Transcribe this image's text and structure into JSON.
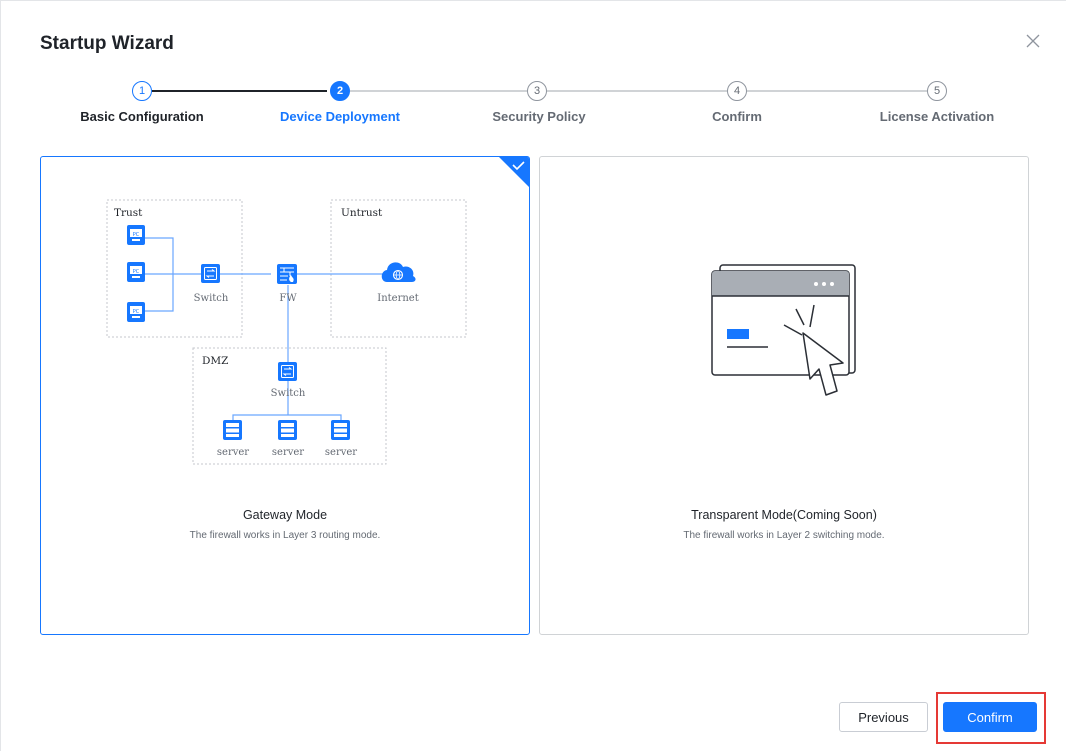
{
  "dialog": {
    "title": "Startup Wizard",
    "close_icon": "close-icon"
  },
  "steps": [
    {
      "number": "1",
      "label": "Basic Configuration",
      "state": "done"
    },
    {
      "number": "2",
      "label": "Device Deployment",
      "state": "active"
    },
    {
      "number": "3",
      "label": "Security Policy",
      "state": "pending"
    },
    {
      "number": "4",
      "label": "Confirm",
      "state": "pending"
    },
    {
      "number": "5",
      "label": "License Activation",
      "state": "pending"
    }
  ],
  "modes": [
    {
      "title": "Gateway Mode",
      "description": "The firewall works in Layer 3 routing mode.",
      "selected": true,
      "diagram": {
        "zones": {
          "trust": "Trust",
          "untrust": "Untrust",
          "dmz": "DMZ"
        },
        "pc_label": "PC",
        "switch_label": "Switch",
        "fw_label": "FW",
        "internet_label": "Internet",
        "dmz_switch_label": "Switch",
        "server_labels": [
          "server",
          "server",
          "server"
        ]
      }
    },
    {
      "title": "Transparent Mode(Coming Soon)",
      "description": "The firewall works in Layer 2 switching mode.",
      "selected": false
    }
  ],
  "footer": {
    "previous_label": "Previous",
    "confirm_label": "Confirm"
  },
  "colors": {
    "primary": "#1677ff",
    "highlight": "#e53935"
  }
}
